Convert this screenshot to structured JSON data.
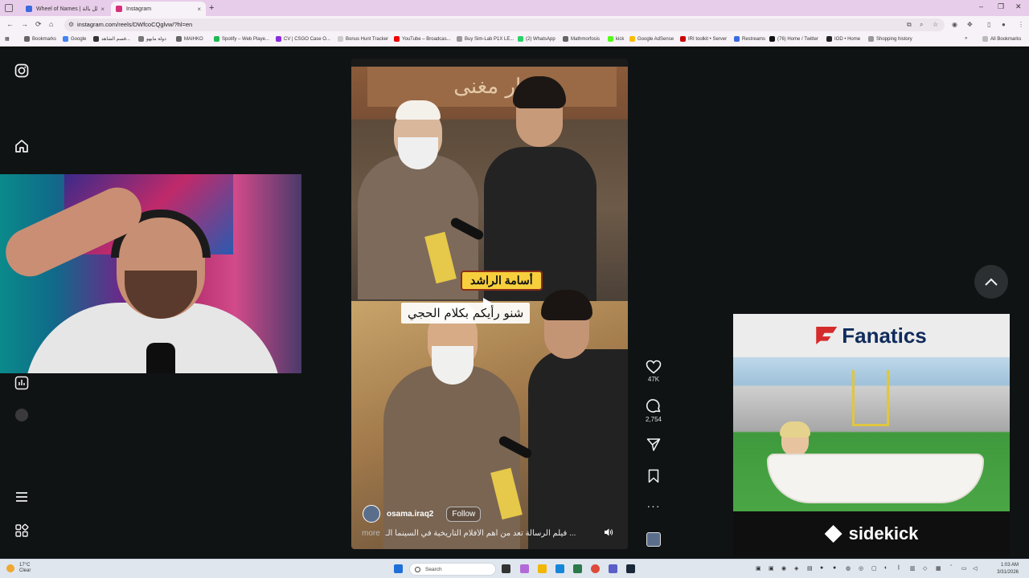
{
  "browser": {
    "tabs": [
      {
        "title": "Wheel of Names | اسم الفالل بالة",
        "favicon_color": "#3b6be0",
        "close": "×"
      },
      {
        "title": "Instagram",
        "favicon_color": "#d6307a",
        "close": "×"
      }
    ],
    "new_tab": "+",
    "window_controls": [
      "–",
      "❐",
      "✕"
    ],
    "nav": {
      "back": "←",
      "forward": "→",
      "reload": "⟳",
      "home": "⌂"
    },
    "url": "instagram.com/reels/DWfcoCQglvw/?hl=en",
    "bookmarks": [
      {
        "label": "Bookmarks",
        "color": "#666"
      },
      {
        "label": "Google",
        "color": "#4285f4"
      },
      {
        "label": "قسم الشاهد...",
        "color": "#333"
      },
      {
        "label": "دولة مايهو",
        "color": "#777"
      },
      {
        "label": "MAIHKO",
        "color": "#666"
      },
      {
        "label": "Spotify – Web Playe...",
        "color": "#1db954"
      },
      {
        "label": "CV | CSGO Case O...",
        "color": "#8a2be2"
      },
      {
        "label": "Bonus Hunt Tracker",
        "color": "#ccc"
      },
      {
        "label": "YouTube – Broadcas...",
        "color": "#e00"
      },
      {
        "label": "Buy Sim-Lab P1X LE...",
        "color": "#999"
      },
      {
        "label": "(2) WhatsApp",
        "color": "#25d366"
      },
      {
        "label": "Mathmorfosis",
        "color": "#666"
      },
      {
        "label": "kick",
        "color": "#53fc18"
      },
      {
        "label": "Google AdSense",
        "color": "#fbbc05"
      },
      {
        "label": "IRI toolkit • Server",
        "color": "#c00"
      },
      {
        "label": "Restreams",
        "color": "#3b6be0"
      },
      {
        "label": "(76) Home / Twitter",
        "color": "#111"
      },
      {
        "label": "IOD • Home",
        "color": "#222"
      },
      {
        "label": "Shopping history",
        "color": "#999"
      }
    ],
    "all_bookmarks": "All Bookmarks"
  },
  "instagram": {
    "sidebar_icons": [
      "instagram-logo-icon",
      "home-icon",
      "insights-icon",
      "profile-avatar",
      "menu-icon",
      "more-apps-icon"
    ],
    "reel": {
      "shop_sign": "دار مغنى",
      "name_overlay": "أسامة الراشد",
      "caption": "شنو رأيكم بكلام الحجي",
      "author": "osama.iraq2",
      "follow": "Follow",
      "description": "فيلم الرسالة تعد من أهم الأفلام التاريخية في السينما الـ ...",
      "more": "more"
    },
    "actions": {
      "likes": "47K",
      "comments": "2,754"
    },
    "ad": {
      "brand": "Fanatics",
      "footer": "sidekick"
    }
  },
  "taskbar": {
    "weather_temp": "17°C",
    "weather_cond": "Clear",
    "search_placeholder": "Search",
    "time": "1:03 AM",
    "date": "3/31/2026"
  }
}
